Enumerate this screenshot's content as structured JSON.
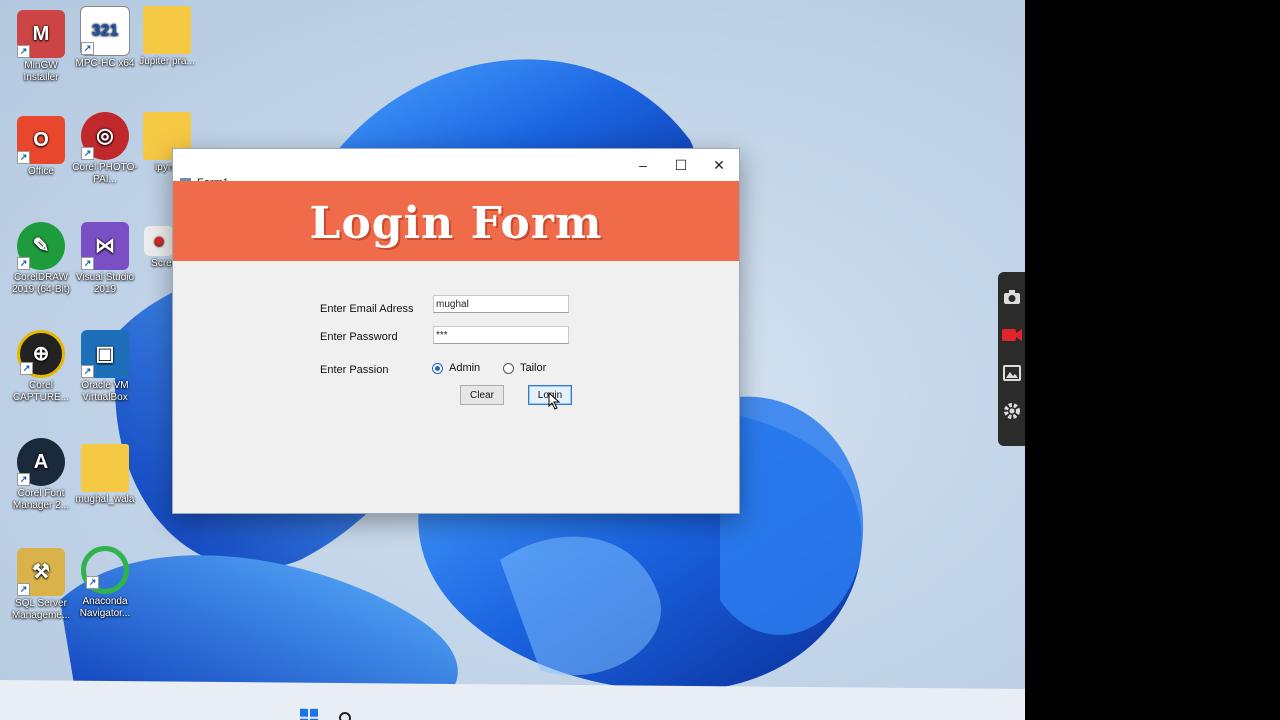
{
  "desktop": {
    "icons": [
      {
        "label": "MinGW Installer"
      },
      {
        "label": "MPC-HC x64"
      },
      {
        "label": "Jupiter pra..."
      },
      {
        "label": "Office"
      },
      {
        "label": "Corel PHOTO-PAI..."
      },
      {
        "label": "ipynb"
      },
      {
        "label": "CorelDRAW 2019 (64-Bit)"
      },
      {
        "label": "Visual Studio 2019"
      },
      {
        "label": "Screen"
      },
      {
        "label": "Corel CAPTURE..."
      },
      {
        "label": "Oracle VM VirtualBox"
      },
      {
        "label": "Corel Font Manager 2..."
      },
      {
        "label": "mughal_wala"
      },
      {
        "label": "SQL Server Manageme..."
      },
      {
        "label": "Anaconda Navigator..."
      }
    ]
  },
  "window": {
    "title": "Form1",
    "minimize": "–",
    "maximize": "☐",
    "close": "✕",
    "banner_title": "Login Form",
    "email_label": "Enter Email Adress",
    "email_value": "mughal",
    "password_label": "Enter Password",
    "password_value": "***",
    "passion_label": "Enter Passion",
    "radio_admin": "Admin",
    "radio_tailor": "Tailor",
    "clear_button": "Clear",
    "login_button": "Login"
  },
  "colors": {
    "banner": "#ef6b4a",
    "accent": "#1f66c2"
  }
}
